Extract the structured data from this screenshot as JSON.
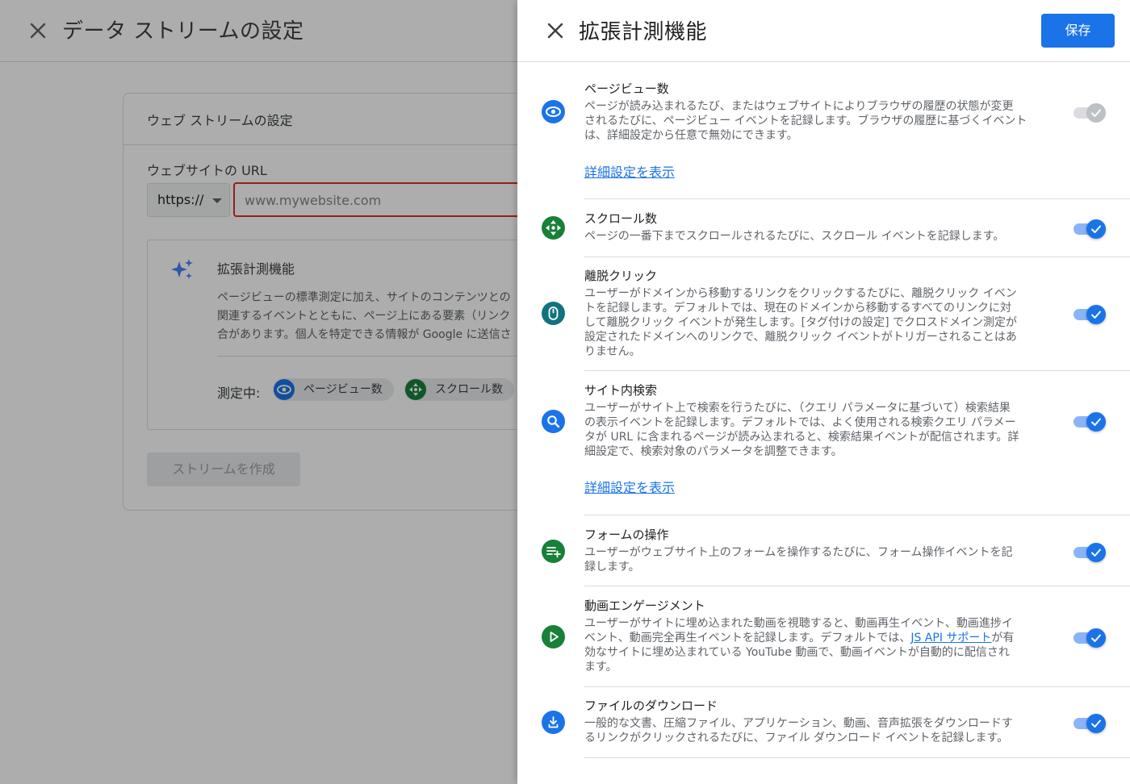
{
  "background": {
    "title": "データ ストリームの設定",
    "card_title": "ウェブ ストリームの設定",
    "url_label": "ウェブサイトの URL",
    "protocol_value": "https://",
    "url_placeholder": "www.mywebsite.com",
    "em_title": "拡張計測機能",
    "em_description": "ページビューの標準測定に加え、サイトのコンテンツとの\n関連するイベントとともに、ページ上にある要素（リンク\n合があります。個人を特定できる情報が Google に送信さ",
    "measuring_label": "測定中:",
    "chips": [
      {
        "label": "ページビュー数",
        "icon": "eye-icon",
        "color": "#1a73e8"
      },
      {
        "label": "スクロール数",
        "icon": "scroll-icon",
        "color": "#188038"
      }
    ],
    "create_button": "ストリームを作成"
  },
  "drawer": {
    "title": "拡張計測機能",
    "save_label": "保存",
    "settings": [
      {
        "title": "ページビュー数",
        "description": "ページが読み込まれるたび、またはウェブサイトによりブラウザの履歴の状態が変更\nされるたびに、ページビュー イベントを記録します。ブラウザの履歴に基づくイベント\nは、詳細設定から任意で無効にできます。",
        "advanced_link": "詳細設定を表示",
        "icon": "eye-icon",
        "icon_color": "#1a73e8",
        "enabled": true,
        "toggle_disabled": true
      },
      {
        "title": "スクロール数",
        "description": "ページの一番下までスクロールされるたびに、スクロール イベントを記録します。",
        "icon": "scroll-icon",
        "icon_color": "#188038",
        "enabled": true
      },
      {
        "title": "離脱クリック",
        "description": "ユーザーがドメインから移動するリンクをクリックするたびに、離脱クリック イベン\nトを記録します。デフォルトでは、現在のドメインから移動するすべてのリンクに対\nして離脱クリック イベントが発生します。[タグ付けの設定] でクロスドメイン測定が\n設定されたドメインへのリンクで、離脱クリック イベントがトリガーされることはあ\nりません。",
        "icon": "mouse-icon",
        "icon_color": "#12737f",
        "enabled": true
      },
      {
        "title": "サイト内検索",
        "description": "ユーザーがサイト上で検索を行うたびに、（クエリ パラメータに基づいて）検索結果\nの表示イベントを記録します。デフォルトでは、よく使用される検索クエリ パラメー\nタが URL に含まれるページが読み込まれると、検索結果イベントが配信されます。詳\n細設定で、検索対象のパラメータを調整できます。",
        "advanced_link": "詳細設定を表示",
        "icon": "search-icon",
        "icon_color": "#1a73e8",
        "enabled": true
      },
      {
        "title": "フォームの操作",
        "description": "ユーザーがウェブサイト上のフォームを操作するたびに、フォーム操作イベントを記\n録します。",
        "icon": "playlist-add-icon",
        "icon_color": "#188038",
        "enabled": true
      },
      {
        "title": "動画エンゲージメント",
        "description_before": "ユーザーがサイトに埋め込まれた動画を視聴すると、動画再生イベント、動画進捗イ\nベント、動画完全再生イベントを記録します。デフォルトでは、",
        "description_link": "JS API サポート",
        "description_after": "が有\n効なサイトに埋め込まれている YouTube 動画で、動画イベントが自動的に配信され\nます。",
        "icon": "play-icon",
        "icon_color": "#188038",
        "enabled": true
      },
      {
        "title": "ファイルのダウンロード",
        "description": "一般的な文書、圧縮ファイル、アプリケーション、動画、音声拡張をダウンロードす\nるリンクがクリックされるたびに、ファイル ダウンロード イベントを記録します。",
        "icon": "download-icon",
        "icon_color": "#1a73e8",
        "enabled": true
      }
    ]
  }
}
